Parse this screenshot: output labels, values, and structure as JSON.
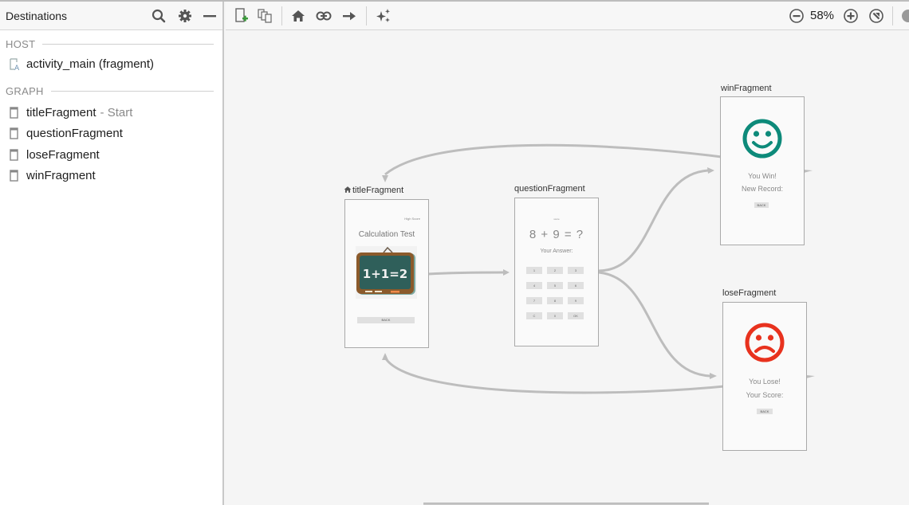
{
  "sidebar": {
    "title": "Destinations",
    "header_icons": [
      "search-icon",
      "gear-icon",
      "minimize-icon"
    ],
    "host_label": "HOST",
    "host_item": "activity_main (fragment)",
    "graph_label": "GRAPH",
    "graph_items": [
      {
        "label": "titleFragment",
        "suffix": "- Start"
      },
      {
        "label": "questionFragment",
        "suffix": ""
      },
      {
        "label": "loseFragment",
        "suffix": ""
      },
      {
        "label": "winFragment",
        "suffix": ""
      }
    ]
  },
  "toolbar": {
    "icons": [
      "new-destination-icon",
      "nested-graph-icon",
      "assign-start-icon",
      "deeplink-icon",
      "add-action-icon",
      "auto-arrange-icon"
    ],
    "zoom_level": "58%",
    "zoom_icons": [
      "zoom-out-icon",
      "zoom-in-icon",
      "zoom-to-fit-icon"
    ]
  },
  "graph": {
    "nodes": {
      "title": {
        "label": "titleFragment",
        "is_start": true,
        "top_right_text": "High Score",
        "heading": "Calculation Test",
        "board_text": "1+1=2",
        "button": "BACK"
      },
      "question": {
        "label": "questionFragment",
        "top_text": "score",
        "expression": "8 + 9 = ?",
        "answer_label": "Your Answer:",
        "keys": [
          "1",
          "2",
          "3",
          "4",
          "5",
          "6",
          "7",
          "8",
          "9",
          "C",
          "0",
          "OK"
        ]
      },
      "win": {
        "label": "winFragment",
        "line1": "You Win!",
        "line2": "New Record:",
        "button": "BACK",
        "face_color": "#0d8a7a"
      },
      "lose": {
        "label": "loseFragment",
        "line1": "You Lose!",
        "line2": "Your Score:",
        "button": "BACK",
        "face_color": "#e8321e"
      }
    },
    "edges": [
      {
        "from": "titleFragment",
        "to": "questionFragment"
      },
      {
        "from": "questionFragment",
        "to": "winFragment"
      },
      {
        "from": "questionFragment",
        "to": "loseFragment"
      },
      {
        "from": "winFragment",
        "to": "titleFragment"
      },
      {
        "from": "loseFragment",
        "to": "titleFragment"
      }
    ]
  }
}
